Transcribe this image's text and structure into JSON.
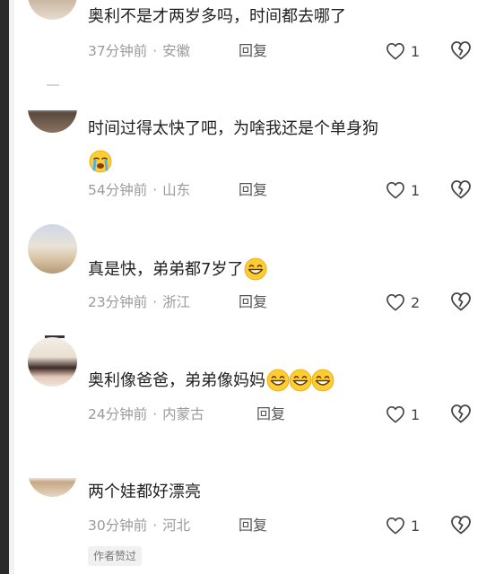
{
  "comments": [
    {
      "text": "奥利不是才两岁多吗，时间都去哪了",
      "time": "37分钟前",
      "location": "安徽",
      "reply": "回复",
      "likes": "1",
      "emojis": []
    },
    {
      "text": "时间过得太快了吧，为啥我还是个单身狗",
      "time": "54分钟前",
      "location": "山东",
      "reply": "回复",
      "likes": "1",
      "emojis": [
        "crying-face"
      ]
    },
    {
      "text": "真是快，弟弟都7岁了",
      "time": "23分钟前",
      "location": "浙江",
      "reply": "回复",
      "likes": "2",
      "emojis": [
        "grinning-face"
      ]
    },
    {
      "text": "奥利像爸爸，弟弟像妈妈",
      "time": "24分钟前",
      "location": "内蒙古",
      "reply": "回复",
      "likes": "1",
      "emojis": [
        "grinning-face",
        "grinning-face",
        "grinning-face"
      ]
    },
    {
      "text": "两个娃都好漂亮",
      "time": "30分钟前",
      "location": "河北",
      "reply": "回复",
      "likes": "1",
      "emojis": [],
      "badge": "作者赞过"
    }
  ],
  "colors": {
    "text": "#1f1f1f",
    "meta": "#9a9a9a",
    "emoji": "#ffcc33"
  }
}
